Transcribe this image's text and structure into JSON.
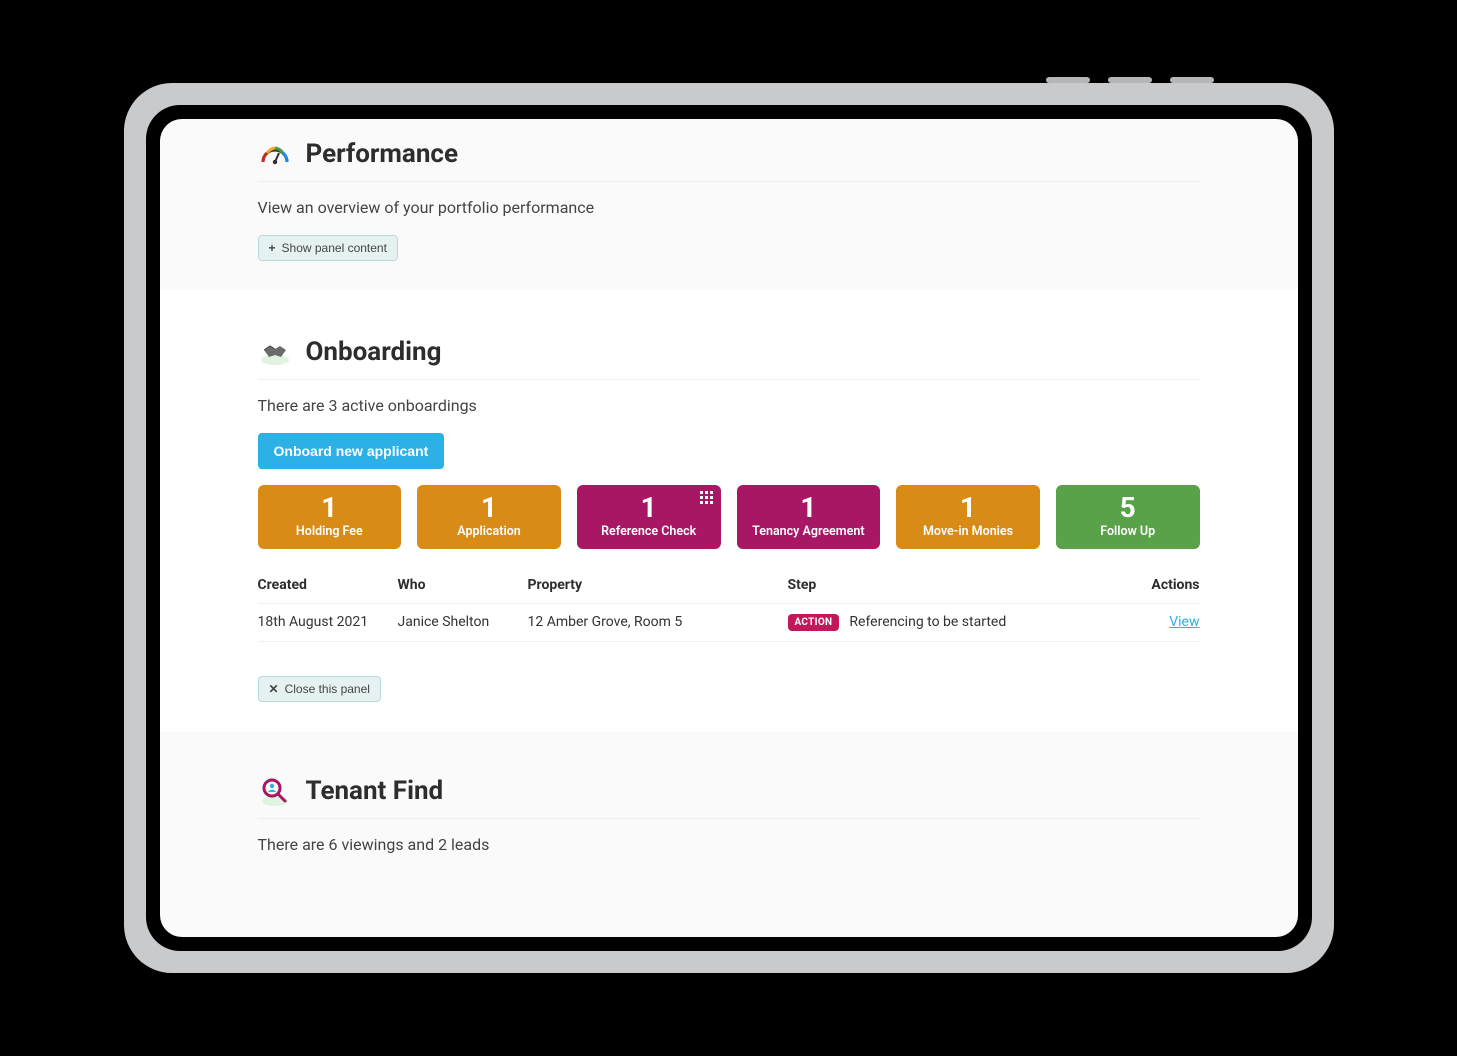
{
  "performance": {
    "title": "Performance",
    "subtitle": "View an overview of your portfolio performance",
    "show_button": "Show panel content"
  },
  "onboarding": {
    "title": "Onboarding",
    "subtitle": "There are 3 active onboardings",
    "primary_button": "Onboard new applicant",
    "tiles": [
      {
        "count": "1",
        "label": "Holding Fee",
        "color": "orange"
      },
      {
        "count": "1",
        "label": "Application",
        "color": "orange"
      },
      {
        "count": "1",
        "label": "Reference Check",
        "color": "magenta",
        "marks": true
      },
      {
        "count": "1",
        "label": "Tenancy Agreement",
        "color": "magenta"
      },
      {
        "count": "1",
        "label": "Move-in Monies",
        "color": "orange"
      },
      {
        "count": "5",
        "label": "Follow Up",
        "color": "green"
      }
    ],
    "columns": {
      "created": "Created",
      "who": "Who",
      "property": "Property",
      "step": "Step",
      "actions": "Actions"
    },
    "rows": [
      {
        "created": "18th August 2021",
        "who": "Janice Shelton",
        "property": "12 Amber Grove, Room 5",
        "badge": "ACTION",
        "step": "Referencing to be started",
        "action_link": "View"
      }
    ],
    "close_button": "Close this panel"
  },
  "tenant_find": {
    "title": "Tenant Find",
    "subtitle": "There are 6 viewings and 2 leads"
  }
}
